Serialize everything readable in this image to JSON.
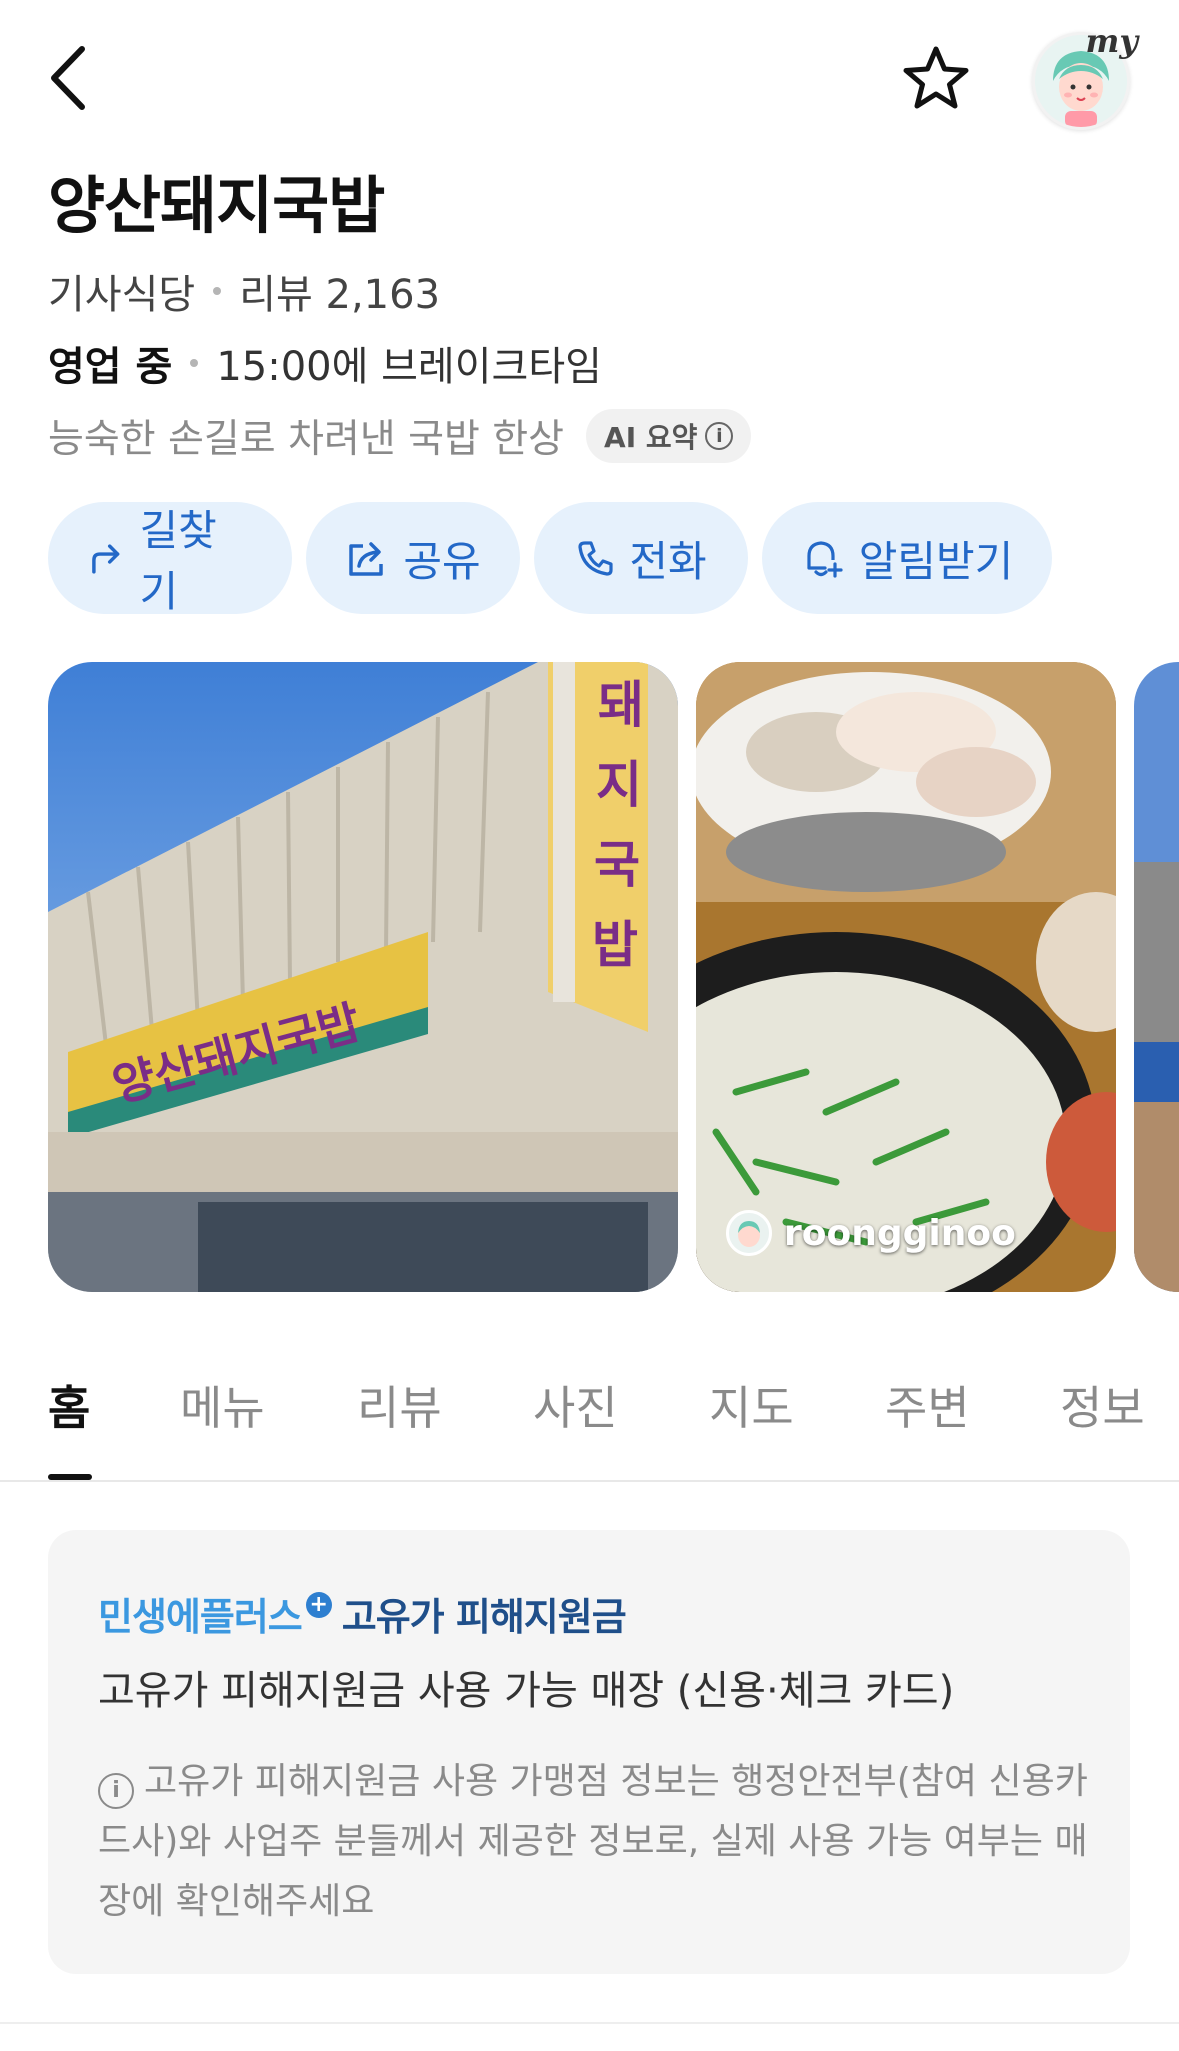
{
  "topbar": {
    "back_icon": "chevron-left-icon",
    "favorite_icon": "star-outline-icon",
    "my_label": "my"
  },
  "place": {
    "name": "양산돼지국밥",
    "category": "기사식당",
    "reviews": "리뷰 2,163",
    "status": "영업 중",
    "hours_note": "15:00에 브레이크타임",
    "summary": "능숙한 손길로 차려낸 국밥 한상",
    "ai_badge": "AI 요약",
    "ai_info": "i"
  },
  "actions": [
    {
      "label": "길찾기",
      "icon": "directions-icon"
    },
    {
      "label": "공유",
      "icon": "share-icon"
    },
    {
      "label": "전화",
      "icon": "phone-icon"
    },
    {
      "label": "알림받기",
      "icon": "bell-plus-icon"
    }
  ],
  "photos": {
    "credit_user": "roongginoo"
  },
  "tabs": [
    "홈",
    "메뉴",
    "리뷰",
    "사진",
    "지도",
    "주변",
    "정보"
  ],
  "active_tab": "홈",
  "card": {
    "promo_brand": "민생에플러스",
    "promo_plus": "+",
    "promo_title": "고유가 피해지원금",
    "main_text": "고유가 피해지원금 사용 가능 매장 (신용·체크 카드)",
    "note_icon": "i",
    "note_text": "고유가 피해지원금 사용 가맹점 정보는 행정안전부(참여 신용카드사)와 사업주 분들께서 제공한 정보로, 실제 사용 가능 여부는 매장에 확인해주세요"
  },
  "colors": {
    "accent_blue": "#2368c7",
    "action_bg": "#e6f1fc",
    "promo_blue": "#3b98e0",
    "muted_text": "#8a8a8a"
  }
}
